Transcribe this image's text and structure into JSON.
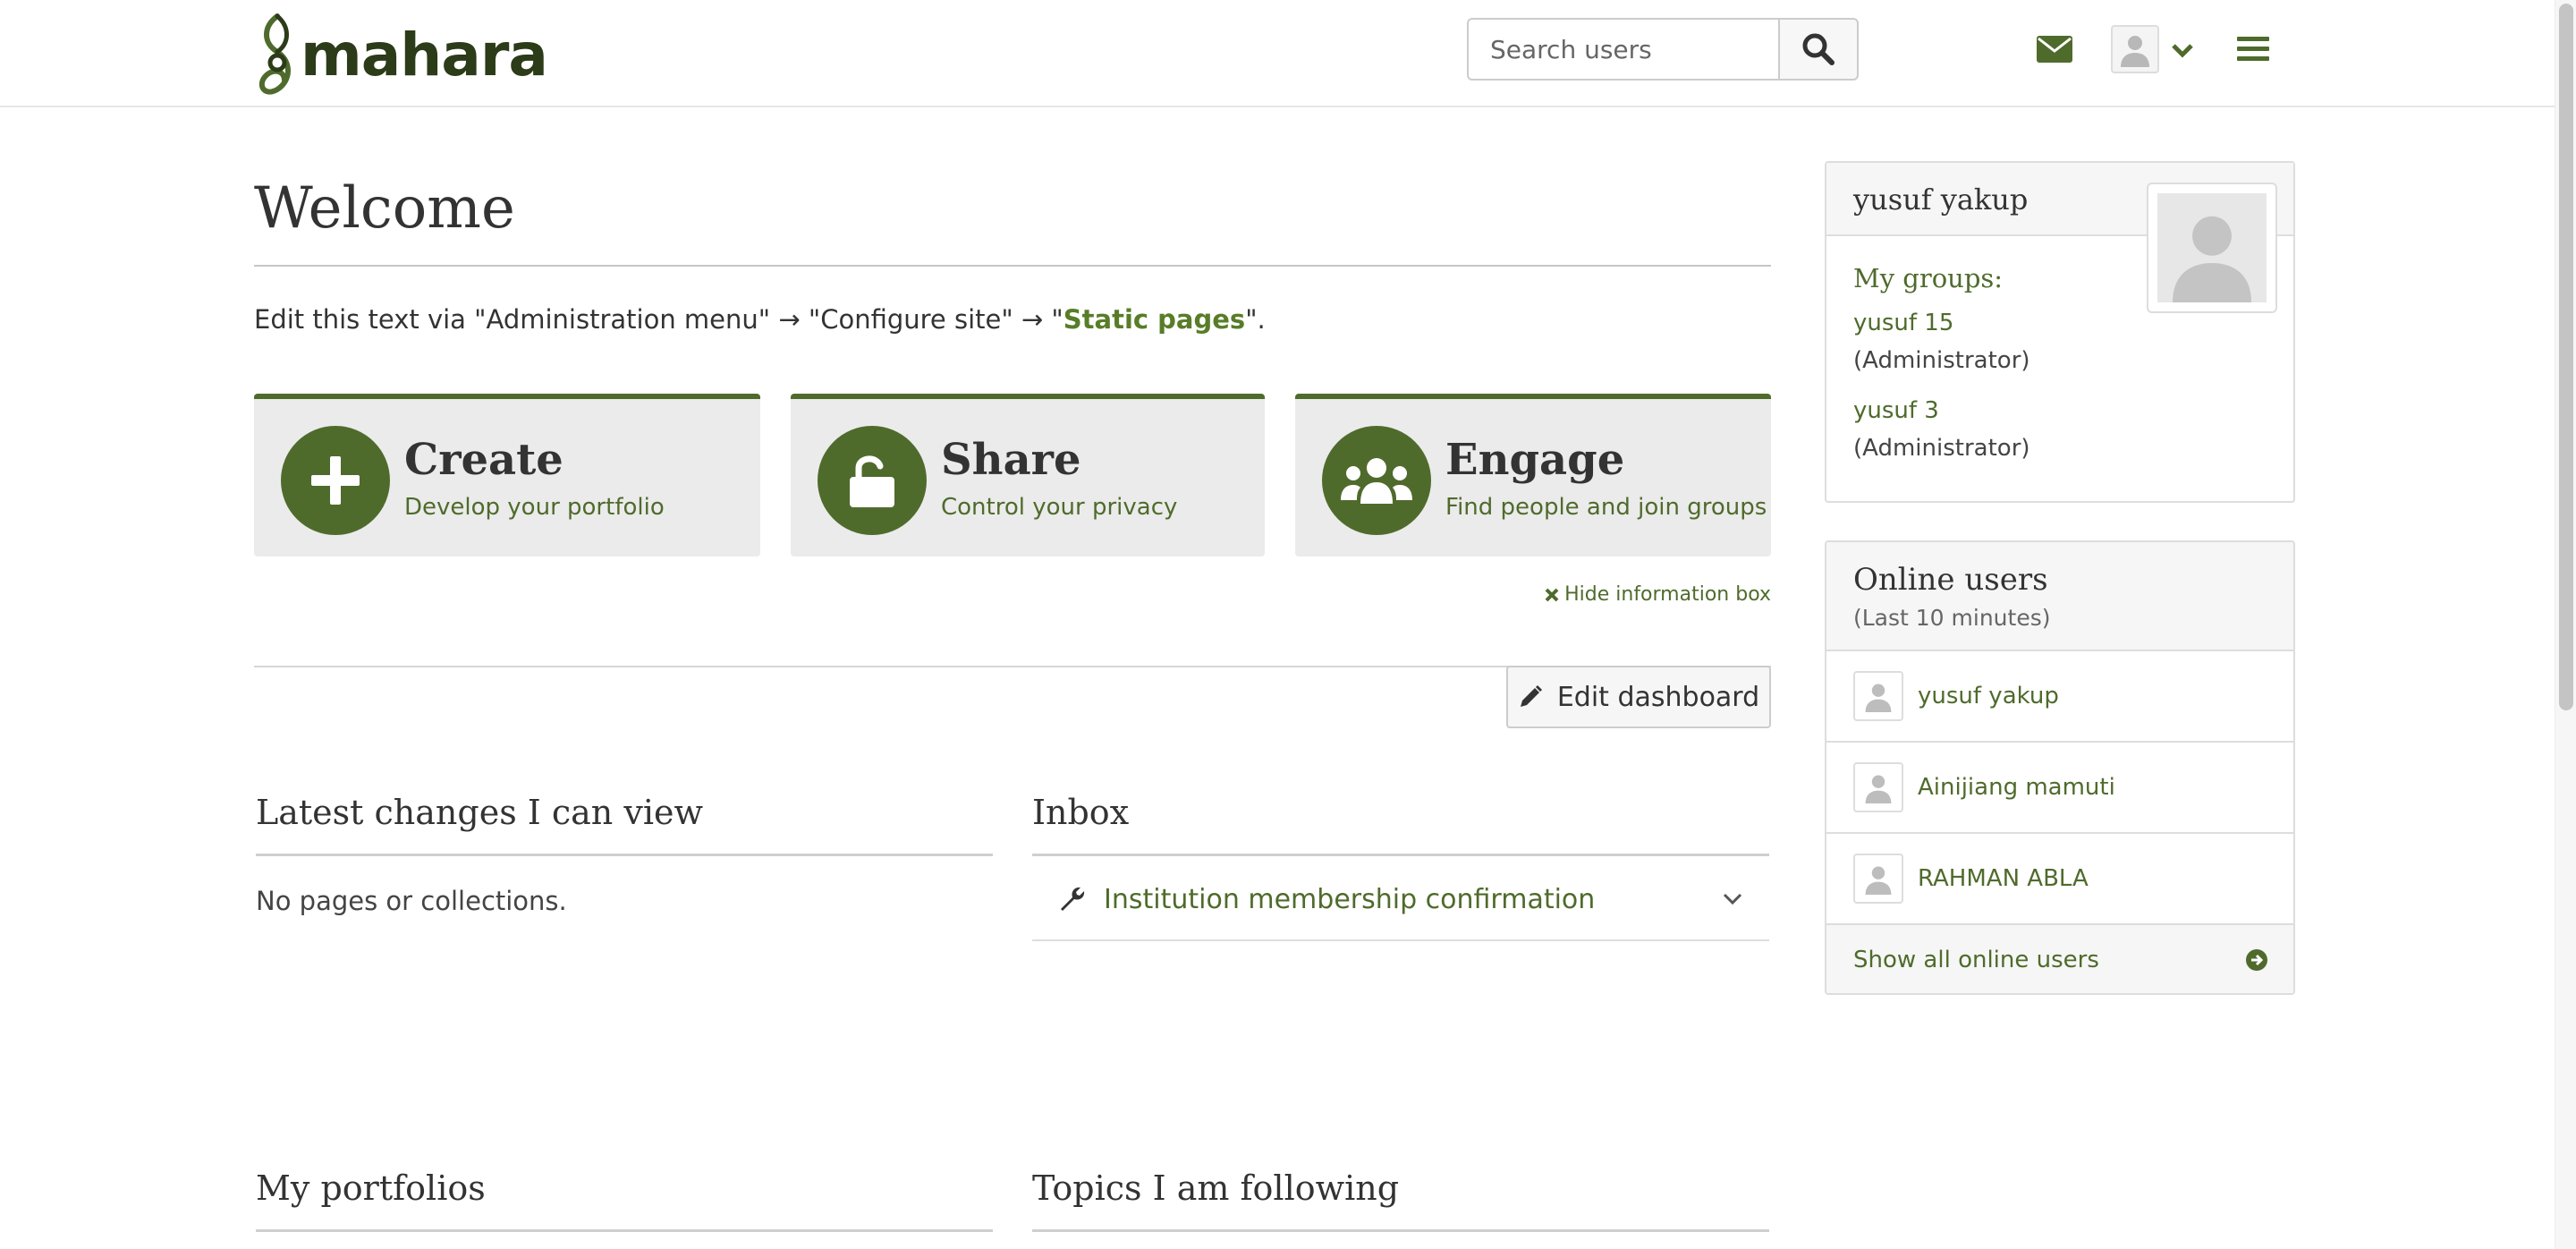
{
  "header": {
    "logo_text": "mahara",
    "search_placeholder": "Search users"
  },
  "main": {
    "title": "Welcome",
    "intro_prefix": "Edit this text via \"Administration menu\" → \"Configure site\" → \"",
    "intro_link": "Static pages",
    "intro_suffix": "\".",
    "cards": [
      {
        "title": "Create",
        "subtitle": "Develop your portfolio",
        "icon": "plus-icon"
      },
      {
        "title": "Share",
        "subtitle": "Control your privacy",
        "icon": "unlock-icon"
      },
      {
        "title": "Engage",
        "subtitle": "Find people and join groups",
        "icon": "users-icon"
      }
    ],
    "hide_info": "Hide information box",
    "edit_dashboard": "Edit dashboard",
    "sections": {
      "latest_changes": {
        "title": "Latest changes I can view",
        "empty": "No pages or collections."
      },
      "inbox": {
        "title": "Inbox",
        "items": [
          {
            "text": "Institution membership confirmation"
          }
        ]
      },
      "my_portfolios": {
        "title": "My portfolios"
      },
      "topics": {
        "title": "Topics I am following"
      }
    }
  },
  "sidebar": {
    "profile": {
      "name": "yusuf yakup",
      "groups_label": "My groups:",
      "groups": [
        {
          "name": "yusuf 15",
          "role": "(Administrator)"
        },
        {
          "name": "yusuf 3",
          "role": "(Administrator)"
        }
      ]
    },
    "online": {
      "title": "Online users",
      "subtitle": "(Last 10 minutes)",
      "users": [
        "yusuf yakup",
        "Ainijiang mamuti",
        "RAHMAN ABLA"
      ],
      "show_all": "Show all online users"
    }
  },
  "colors": {
    "accent": "#4f6b2c",
    "logo": "#2c3b18",
    "card_bg": "#ebebeb"
  }
}
